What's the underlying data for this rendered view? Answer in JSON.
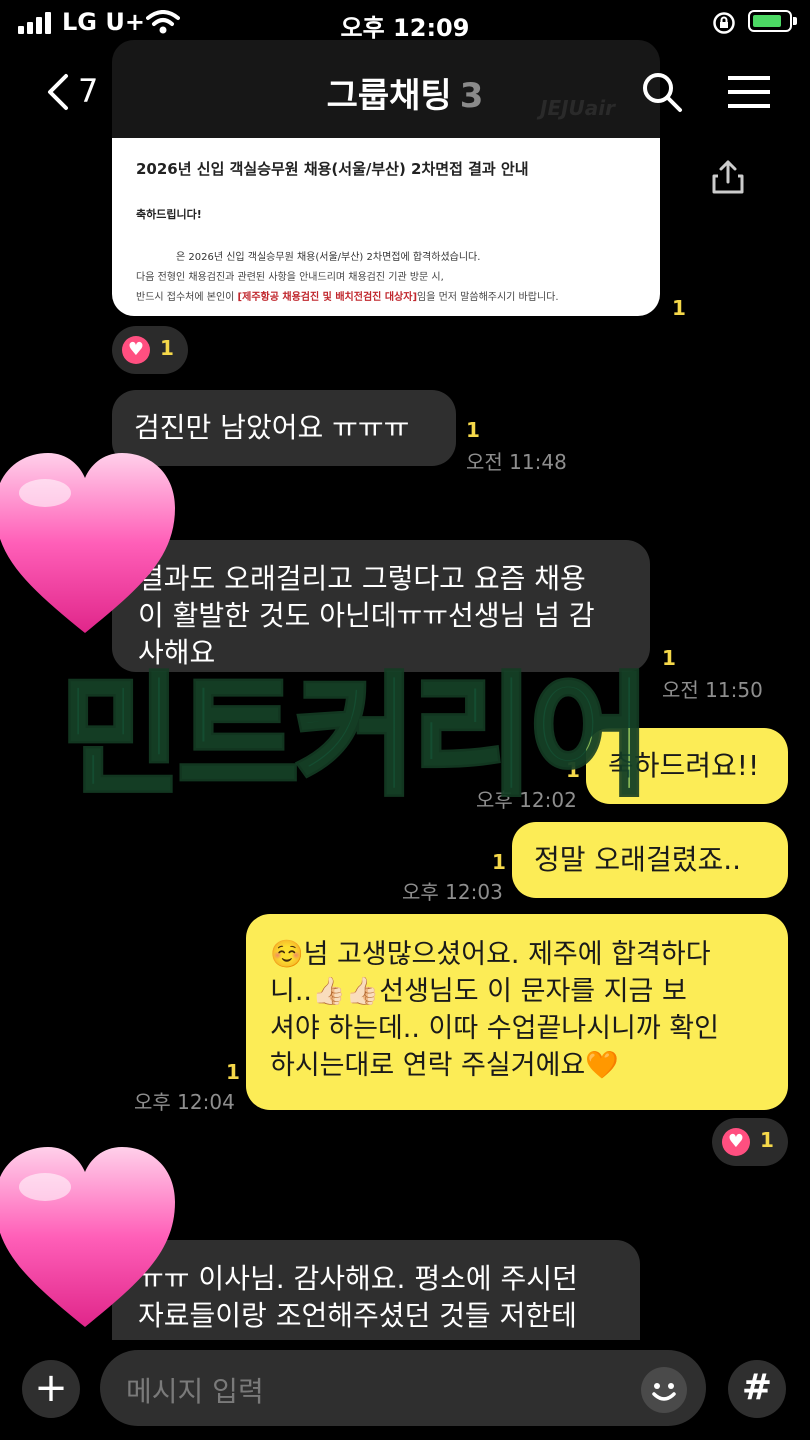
{
  "status_bar": {
    "carrier": "LG U+",
    "time": "오후 12:09"
  },
  "header": {
    "back_count": "7",
    "title": "그룹채팅",
    "member_count": "3"
  },
  "shared_image": {
    "brand": "JEJUair",
    "doc_title": "2026년 신입 객실승무원 채용(서울/부산) 2차면접 결과 안내",
    "line1": "축하드립니다!",
    "line2": "은 2026년 신입 객실승무원 채용(서울/부산) 2차면접에 합격하셨습니다.",
    "line3": "다음 전형인 채용검진과 관련된 사항을 안내드리며 채용검진 기관 방문 시,",
    "line4_pre": "반드시 접수처에 본인이 ",
    "line4_red": "[제주항공 채용검진 및 배치전검진 대상자]",
    "line4_post": "임을 먼저 말씀해주시기 바랍니다.",
    "unread": "1",
    "reaction_count": "1"
  },
  "messages": [
    {
      "text": "검진만 남았어요 ㅠㅠㅠ",
      "unread": "1",
      "time": "오전 11:48"
    },
    {
      "text": "결과도 오래걸리고 그렇다고 요즘 채용이 활발한 것도 아닌데ㅠㅠ선생님 넘 감사해요",
      "line1": "결과도 오래걸리고 그렇다고 요즘 채용",
      "line2": "이 활발한 것도 아닌데ㅠㅠ선생님 넘 감",
      "line3": "사해요",
      "unread": "1",
      "time": "오전 11:50"
    },
    {
      "text": "축하드려요!!",
      "unread": "1",
      "time": "오후 12:02"
    },
    {
      "text": "정말 오래걸렸죠..",
      "unread": "1",
      "time": "오후 12:03"
    },
    {
      "line1": "☺️넘 고생많으셨어요. 제주에 합격하다",
      "line2": "니..👍🏻👍🏻선생님도 이 문자를 지금 보",
      "line3": "셔야 하는데.. 이따 수업끝나시니까 확인",
      "line4": "하시는대로 연락 주실거에요🧡",
      "unread": "1",
      "time": "오후 12:04",
      "reaction_count": "1"
    },
    {
      "line1": "ㅠㅠ 이사님. 감사해요. 평소에 주시던",
      "line2": "자료들이랑 조언해주셨던 것들 저한테"
    }
  ],
  "watermark": "민트커리어",
  "input": {
    "placeholder": "메시지 입력"
  },
  "colors": {
    "background": "#000000",
    "my_bubble": "#fcec56",
    "their_bubble": "#2f2f2f",
    "unread": "#f5d84a",
    "reaction_heart": "#ff4f80"
  }
}
